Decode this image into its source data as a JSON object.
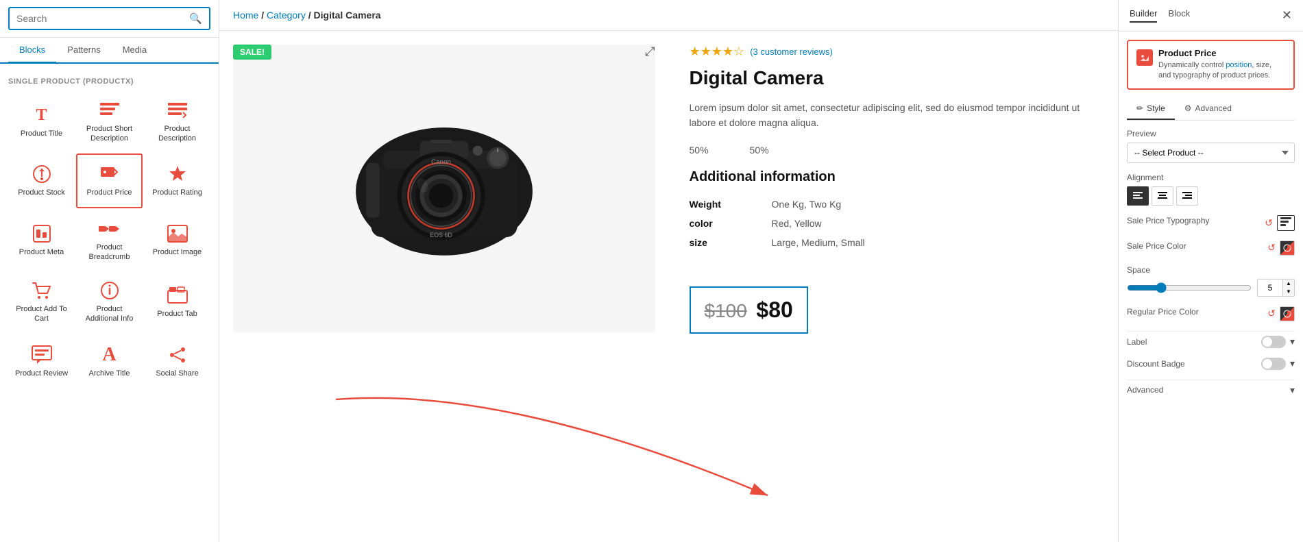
{
  "leftPanel": {
    "searchPlaceholder": "Search",
    "tabs": [
      {
        "id": "blocks",
        "label": "Blocks",
        "active": true
      },
      {
        "id": "patterns",
        "label": "Patterns",
        "active": false
      },
      {
        "id": "media",
        "label": "Media",
        "active": false
      }
    ],
    "sectionLabel": "SINGLE PRODUCT (PRODUCTX)",
    "blocks": [
      {
        "id": "product-title",
        "label": "Product Title",
        "icon": "T",
        "iconType": "text-t",
        "selected": false
      },
      {
        "id": "product-short-desc",
        "label": "Product Short Description",
        "icon": "≡",
        "iconType": "lines",
        "selected": false
      },
      {
        "id": "product-description",
        "label": "Product Description",
        "icon": "≡+",
        "iconType": "lines-check",
        "selected": false
      },
      {
        "id": "product-stock",
        "label": "Product Stock",
        "icon": "◈",
        "iconType": "tag-circle",
        "selected": false
      },
      {
        "id": "product-price",
        "label": "Product Price",
        "icon": "🏷",
        "iconType": "tag",
        "selected": true
      },
      {
        "id": "product-rating",
        "label": "Product Rating",
        "icon": "★",
        "iconType": "star",
        "selected": false
      },
      {
        "id": "product-meta",
        "label": "Product Meta",
        "icon": "⊡",
        "iconType": "meta",
        "selected": false
      },
      {
        "id": "product-breadcrumb",
        "label": "Product Breadcrumb",
        "icon": "▶▶",
        "iconType": "breadcrumb",
        "selected": false
      },
      {
        "id": "product-image",
        "label": "Product Image",
        "icon": "🖼",
        "iconType": "image",
        "selected": false
      },
      {
        "id": "product-add-to-cart",
        "label": "Product Add To Cart",
        "icon": "🛒",
        "iconType": "cart",
        "selected": false
      },
      {
        "id": "product-additional-info",
        "label": "Product Additional Info",
        "icon": "ℹ",
        "iconType": "info-circle",
        "selected": false
      },
      {
        "id": "product-tab",
        "label": "Product Tab",
        "icon": "☰",
        "iconType": "tab",
        "selected": false
      },
      {
        "id": "product-review",
        "label": "Product Review",
        "icon": "⊞",
        "iconType": "review",
        "selected": false
      },
      {
        "id": "archive-title",
        "label": "Archive Title",
        "icon": "A",
        "iconType": "archive-a",
        "selected": false
      },
      {
        "id": "social-share",
        "label": "Social Share",
        "icon": "⎇",
        "iconType": "share",
        "selected": false
      }
    ]
  },
  "canvas": {
    "breadcrumb": {
      "home": "Home",
      "separator1": "/",
      "category": "Category",
      "separator2": "/",
      "current": "Digital Camera"
    },
    "product": {
      "saleBadge": "SALE!",
      "title": "Digital Camera",
      "ratingStars": 4,
      "reviewsText": "(3 customer reviews)",
      "description": "Lorem ipsum dolor sit amet, consectetur adipiscing elit, sed do eiusmod tempor incididunt ut labore et dolore magna aliqua.",
      "percent1": "50%",
      "percent2": "50%",
      "additionalInfoTitle": "Additional information",
      "specs": [
        {
          "key": "Weight",
          "value": "One Kg, Two Kg"
        },
        {
          "key": "color",
          "value": "Red, Yellow"
        },
        {
          "key": "size",
          "value": "Large, Medium, Small"
        }
      ],
      "priceOriginal": "$100",
      "priceSale": "$80"
    }
  },
  "rightPanel": {
    "tabs": [
      {
        "id": "builder",
        "label": "Builder",
        "active": true
      },
      {
        "id": "block",
        "label": "Block",
        "active": false
      }
    ],
    "blockInfo": {
      "title": "Product Price",
      "description": "Dynamically control position, size, and typography of product prices.",
      "linkText": "position"
    },
    "styleTabs": [
      {
        "id": "style",
        "label": "Style",
        "icon": "✏",
        "active": true
      },
      {
        "id": "advanced",
        "label": "Advanced",
        "icon": "⚙",
        "active": false
      }
    ],
    "previewLabel": "Preview",
    "previewPlaceholder": "-- Select Product --",
    "previewOptions": [
      "-- Select Product --"
    ],
    "alignmentLabel": "Alignment",
    "alignmentOptions": [
      {
        "id": "left",
        "icon": "≡",
        "active": true
      },
      {
        "id": "center",
        "icon": "≡",
        "active": false
      },
      {
        "id": "right",
        "icon": "≡",
        "active": false
      }
    ],
    "salePriceTypographyLabel": "Sale Price Typography",
    "salePriceColorLabel": "Sale Price Color",
    "spaceLabel": "Space",
    "spaceValue": "5",
    "regularPriceColorLabel": "Regular Price Color",
    "labelLabel": "Label",
    "labelToggleOn": false,
    "discountBadgeLabel": "Discount Badge",
    "discountBadgeToggleOn": false,
    "advancedLabel": "Advanced"
  }
}
